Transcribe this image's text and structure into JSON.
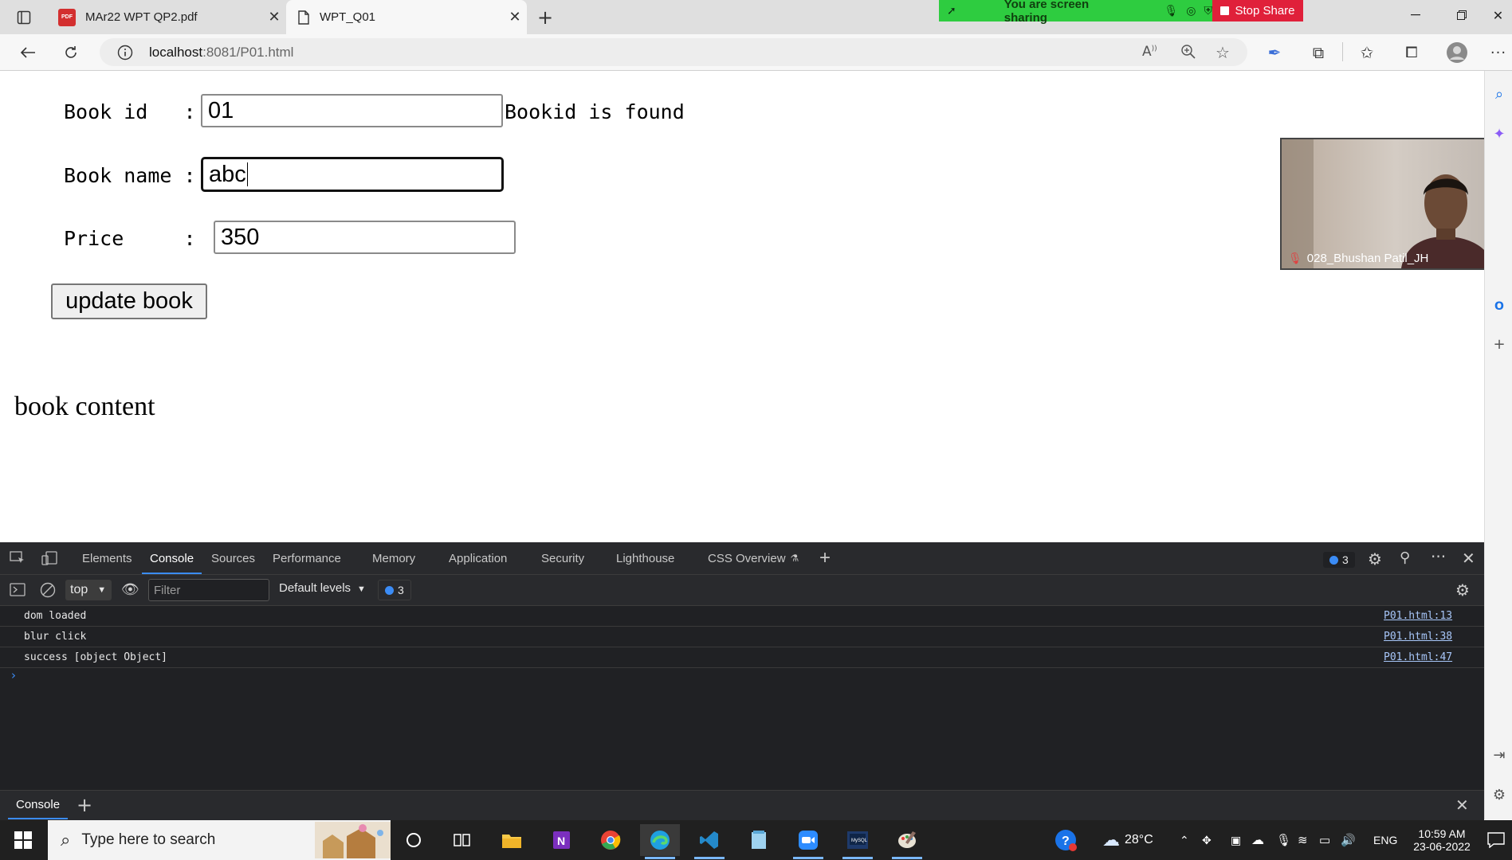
{
  "tabs": [
    {
      "title": "MAr22 WPT QP2.pdf",
      "favicon": "PDF",
      "active": false
    },
    {
      "title": "WPT_Q01",
      "active": true
    }
  ],
  "screen_share": {
    "banner": "You are screen sharing",
    "stop": "Stop Share"
  },
  "address_bar": {
    "host": "localhost",
    "rest": ":8081/P01.html"
  },
  "form": {
    "book_id_label": "Book id   :",
    "book_id_value": "01",
    "book_id_status": "Bookid is found",
    "book_name_label": "Book name :",
    "book_name_value": "abc",
    "price_label": "Price     :",
    "price_value": "350",
    "update_button": "update book",
    "content_text": "book content"
  },
  "video": {
    "participant": "028_Bhushan Patil_JH"
  },
  "devtools": {
    "tabs": [
      "Elements",
      "Console",
      "Sources",
      "Performance",
      "Memory",
      "Application",
      "Security",
      "Lighthouse",
      "CSS Overview"
    ],
    "active_tab": "Console",
    "issue_count": "3",
    "context": "top",
    "filter_placeholder": "Filter",
    "levels": "Default levels",
    "message_count": "3",
    "logs": [
      {
        "message": "dom loaded",
        "source": "P01.html:13"
      },
      {
        "message": "blur click",
        "source": "P01.html:38"
      },
      {
        "message": "success [object Object]",
        "source": "P01.html:47"
      }
    ],
    "drawer_tab": "Console"
  },
  "taskbar": {
    "search_placeholder": "Type here to search",
    "weather": "28°C",
    "language": "ENG",
    "time": "10:59 AM",
    "date": "23-06-2022"
  },
  "colors": {
    "share_green": "#2ecc40",
    "stop_red": "#e0203a",
    "devtools_bg": "#202124",
    "accent_blue": "#3b8cf6",
    "taskbar_bg": "#202020"
  }
}
